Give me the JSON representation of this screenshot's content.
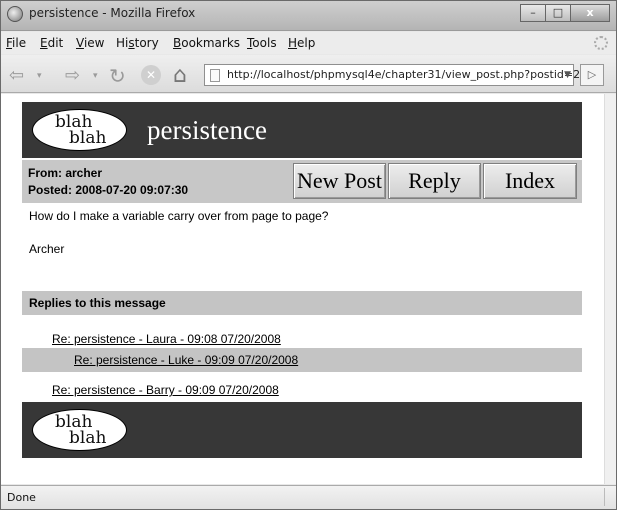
{
  "window": {
    "title": "persistence - Mozilla Firefox",
    "controls": {
      "minimize": "–",
      "maximize": "□",
      "close": "x"
    }
  },
  "menu": [
    {
      "label": "File",
      "accel": "F",
      "rest": "ile"
    },
    {
      "label": "Edit",
      "accel": "E",
      "rest": "dit"
    },
    {
      "label": "View",
      "accel": "V",
      "rest": "iew"
    },
    {
      "label": "History",
      "pre": "Hi",
      "accel": "s",
      "rest": "tory"
    },
    {
      "label": "Bookmarks",
      "accel": "B",
      "rest": "ookmarks"
    },
    {
      "label": "Tools",
      "accel": "T",
      "rest": "ools"
    },
    {
      "label": "Help",
      "accel": "H",
      "rest": "elp"
    }
  ],
  "toolbar": {
    "back": "⇦",
    "forward": "⇨",
    "reload": "↻",
    "stop": "✕",
    "home": "⌂",
    "url": "http://localhost/phpmysql4e/chapter31/view_post.php?postid=2",
    "dropdown": "▼",
    "go": "▷"
  },
  "page": {
    "logo_line1": "blah",
    "logo_line2": "blah",
    "site_title": "persistence",
    "from": "From: archer",
    "posted": "Posted: 2008-07-20 09:07:30",
    "buttons": {
      "new_post": "New Post",
      "reply": "Reply",
      "index": "Index"
    },
    "message": "How do I make a variable carry over from page to page?",
    "signature": "Archer",
    "replies_heading": "Replies to this message",
    "replies": [
      "Re: persistence - Laura - 09:08 07/20/2008",
      "Re: persistence - Luke - 09:09 07/20/2008",
      "Re: persistence - Barry - 09:09 07/20/2008"
    ]
  },
  "status": "Done",
  "icons": {
    "firefox": "firefox-icon",
    "back": "back-arrow-icon",
    "forward": "forward-arrow-icon",
    "reload": "reload-icon",
    "stop": "stop-icon",
    "home": "home-icon",
    "page": "page-icon"
  },
  "colors": {
    "header_bg": "#373737",
    "bar_bg": "#c7c7c7",
    "title_text": "#ffffff"
  }
}
